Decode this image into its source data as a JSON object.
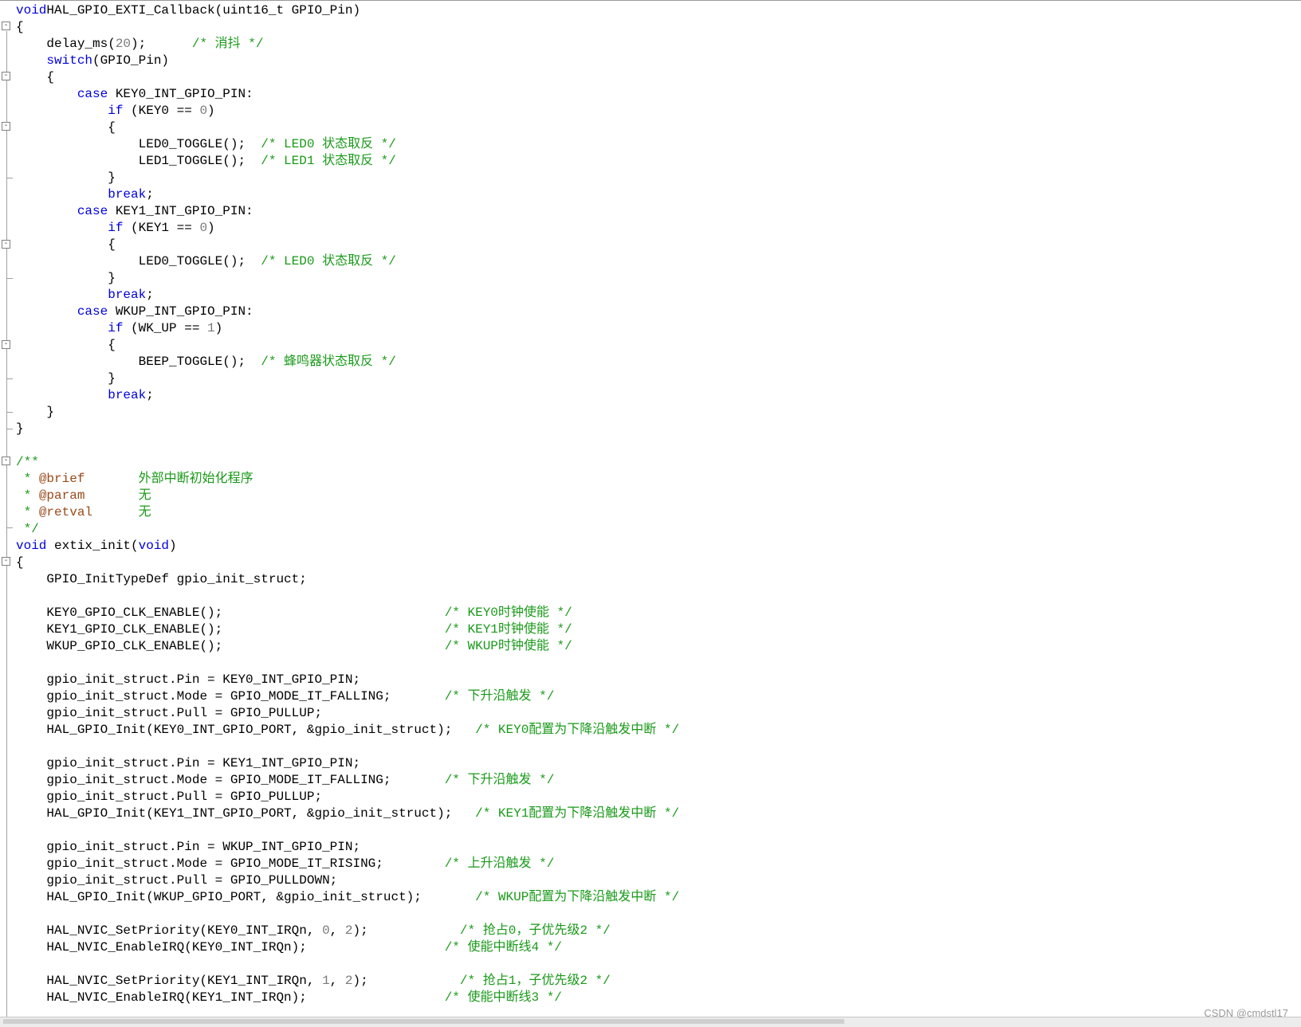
{
  "code_lines": [
    [
      [
        "kw",
        "void"
      ],
      [
        "",
        "HAL_GPIO_EXTI_Callback(uint16_t GPIO_Pin)"
      ]
    ],
    [
      [
        "",
        "{"
      ]
    ],
    [
      [
        "",
        "    delay_ms("
      ],
      [
        "num",
        "20"
      ],
      [
        "",
        "); "
      ],
      [
        "cm",
        "     /* 消抖 */"
      ]
    ],
    [
      [
        "",
        "    "
      ],
      [
        "kw",
        "switch"
      ],
      [
        "",
        "(GPIO_Pin)"
      ]
    ],
    [
      [
        "",
        "    {"
      ]
    ],
    [
      [
        "",
        "        "
      ],
      [
        "kw",
        "case"
      ],
      [
        "",
        " KEY0_INT_GPIO_PIN:"
      ]
    ],
    [
      [
        "",
        "            "
      ],
      [
        "kw",
        "if"
      ],
      [
        "",
        " (KEY0 == "
      ],
      [
        "num",
        "0"
      ],
      [
        "",
        ")"
      ]
    ],
    [
      [
        "",
        "            {"
      ]
    ],
    [
      [
        "",
        "                LED0_TOGGLE();  "
      ],
      [
        "cm",
        "/* LED0 状态取反 */"
      ]
    ],
    [
      [
        "",
        "                LED1_TOGGLE();  "
      ],
      [
        "cm",
        "/* LED1 状态取反 */"
      ]
    ],
    [
      [
        "",
        "            }"
      ]
    ],
    [
      [
        "",
        "            "
      ],
      [
        "kw",
        "break"
      ],
      [
        "",
        ";"
      ]
    ],
    [
      [
        "",
        "        "
      ],
      [
        "kw",
        "case"
      ],
      [
        "",
        " KEY1_INT_GPIO_PIN:"
      ]
    ],
    [
      [
        "",
        "            "
      ],
      [
        "kw",
        "if"
      ],
      [
        "",
        " (KEY1 == "
      ],
      [
        "num",
        "0"
      ],
      [
        "",
        ")"
      ]
    ],
    [
      [
        "",
        "            {"
      ]
    ],
    [
      [
        "",
        "                LED0_TOGGLE();  "
      ],
      [
        "cm",
        "/* LED0 状态取反 */"
      ]
    ],
    [
      [
        "",
        "            }"
      ]
    ],
    [
      [
        "",
        "            "
      ],
      [
        "kw",
        "break"
      ],
      [
        "",
        ";"
      ]
    ],
    [
      [
        "",
        "        "
      ],
      [
        "kw",
        "case"
      ],
      [
        "",
        " WKUP_INT_GPIO_PIN:"
      ]
    ],
    [
      [
        "",
        "            "
      ],
      [
        "kw",
        "if"
      ],
      [
        "",
        " (WK_UP == "
      ],
      [
        "num",
        "1"
      ],
      [
        "",
        ")"
      ]
    ],
    [
      [
        "",
        "            {"
      ]
    ],
    [
      [
        "",
        "                BEEP_TOGGLE();  "
      ],
      [
        "cm",
        "/* 蜂鸣器状态取反 */"
      ]
    ],
    [
      [
        "",
        "            }"
      ]
    ],
    [
      [
        "",
        "            "
      ],
      [
        "kw",
        "break"
      ],
      [
        "",
        ";"
      ]
    ],
    [
      [
        "",
        "    }"
      ]
    ],
    [
      [
        "",
        "}"
      ]
    ],
    [
      [
        "",
        ""
      ]
    ],
    [
      [
        "cm",
        "/**"
      ]
    ],
    [
      [
        "cm",
        " * "
      ],
      [
        "tag",
        "@brief"
      ],
      [
        "cm",
        "       外部中断初始化程序"
      ]
    ],
    [
      [
        "cm",
        " * "
      ],
      [
        "tag",
        "@param"
      ],
      [
        "cm",
        "       无"
      ]
    ],
    [
      [
        "cm",
        " * "
      ],
      [
        "tag",
        "@retval"
      ],
      [
        "cm",
        "      无"
      ]
    ],
    [
      [
        "cm",
        " */"
      ]
    ],
    [
      [
        "kw",
        "void"
      ],
      [
        "",
        " extix_init("
      ],
      [
        "kw",
        "void"
      ],
      [
        "",
        ")"
      ]
    ],
    [
      [
        "",
        "{"
      ]
    ],
    [
      [
        "",
        "    GPIO_InitTypeDef gpio_init_struct;"
      ]
    ],
    [
      [
        "",
        ""
      ]
    ],
    [
      [
        "",
        "    KEY0_GPIO_CLK_ENABLE();                             "
      ],
      [
        "cm",
        "/* KEY0时钟使能 */"
      ]
    ],
    [
      [
        "",
        "    KEY1_GPIO_CLK_ENABLE();                             "
      ],
      [
        "cm",
        "/* KEY1时钟使能 */"
      ]
    ],
    [
      [
        "",
        "    WKUP_GPIO_CLK_ENABLE();                             "
      ],
      [
        "cm",
        "/* WKUP时钟使能 */"
      ]
    ],
    [
      [
        "",
        ""
      ]
    ],
    [
      [
        "",
        "    gpio_init_struct.Pin = KEY0_INT_GPIO_PIN;"
      ]
    ],
    [
      [
        "",
        "    gpio_init_struct.Mode = GPIO_MODE_IT_FALLING;       "
      ],
      [
        "cm",
        "/* 下升沿触发 */"
      ]
    ],
    [
      [
        "",
        "    gpio_init_struct.Pull = GPIO_PULLUP;"
      ]
    ],
    [
      [
        "",
        "    HAL_GPIO_Init(KEY0_INT_GPIO_PORT, &gpio_init_struct);   "
      ],
      [
        "cm",
        "/* KEY0配置为下降沿触发中断 */"
      ]
    ],
    [
      [
        "",
        ""
      ]
    ],
    [
      [
        "",
        "    gpio_init_struct.Pin = KEY1_INT_GPIO_PIN;"
      ]
    ],
    [
      [
        "",
        "    gpio_init_struct.Mode = GPIO_MODE_IT_FALLING;       "
      ],
      [
        "cm",
        "/* 下升沿触发 */"
      ]
    ],
    [
      [
        "",
        "    gpio_init_struct.Pull = GPIO_PULLUP;"
      ]
    ],
    [
      [
        "",
        "    HAL_GPIO_Init(KEY1_INT_GPIO_PORT, &gpio_init_struct);   "
      ],
      [
        "cm",
        "/* KEY1配置为下降沿触发中断 */"
      ]
    ],
    [
      [
        "",
        ""
      ]
    ],
    [
      [
        "",
        "    gpio_init_struct.Pin = WKUP_INT_GPIO_PIN;"
      ]
    ],
    [
      [
        "",
        "    gpio_init_struct.Mode = GPIO_MODE_IT_RISING;        "
      ],
      [
        "cm",
        "/* 上升沿触发 */"
      ]
    ],
    [
      [
        "",
        "    gpio_init_struct.Pull = GPIO_PULLDOWN;"
      ]
    ],
    [
      [
        "",
        "    HAL_GPIO_Init(WKUP_GPIO_PORT, &gpio_init_struct);       "
      ],
      [
        "cm",
        "/* WKUP配置为下降沿触发中断 */"
      ]
    ],
    [
      [
        "",
        ""
      ]
    ],
    [
      [
        "",
        "    HAL_NVIC_SetPriority(KEY0_INT_IRQn, "
      ],
      [
        "num",
        "0"
      ],
      [
        "",
        ", "
      ],
      [
        "num",
        "2"
      ],
      [
        "",
        ");            "
      ],
      [
        "cm",
        "/* 抢占0，子优先级2 */"
      ]
    ],
    [
      [
        "",
        "    HAL_NVIC_EnableIRQ(KEY0_INT_IRQn);                  "
      ],
      [
        "cm",
        "/* 使能中断线4 */"
      ]
    ],
    [
      [
        "",
        ""
      ]
    ],
    [
      [
        "",
        "    HAL_NVIC_SetPriority(KEY1_INT_IRQn, "
      ],
      [
        "num",
        "1"
      ],
      [
        "",
        ", "
      ],
      [
        "num",
        "2"
      ],
      [
        "",
        ");            "
      ],
      [
        "cm",
        "/* 抢占1，子优先级2 */"
      ]
    ],
    [
      [
        "",
        "    HAL_NVIC_EnableIRQ(KEY1_INT_IRQn);                  "
      ],
      [
        "cm",
        "/* 使能中断线3 */"
      ]
    ]
  ],
  "fold_markers": [
    "-",
    "-",
    "-",
    "-",
    "-",
    "-",
    "-"
  ],
  "watermark": "CSDN @cmdstl17"
}
